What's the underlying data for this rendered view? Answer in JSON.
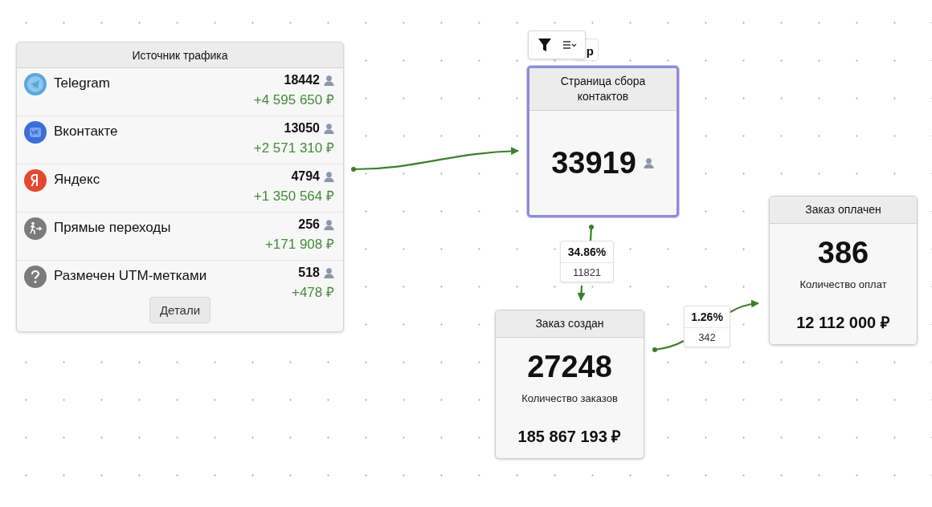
{
  "source_panel": {
    "title": "Источник трафика",
    "sources": [
      {
        "kind": "telegram",
        "name": "Telegram",
        "count": "18442",
        "revenue": "+4 595 650 ₽"
      },
      {
        "kind": "vk",
        "name": "Вконтакте",
        "count": "13050",
        "revenue": "+2 571 310 ₽"
      },
      {
        "kind": "yandex",
        "name": "Яндекс",
        "count": "4794",
        "revenue": "+1 350 564 ₽"
      },
      {
        "kind": "direct",
        "name": "Прямые переходы",
        "count": "256",
        "revenue": "+171 908 ₽"
      },
      {
        "kind": "utm",
        "name": "Размечен UTM-метками",
        "count": "518",
        "revenue": "+478 ₽"
      }
    ],
    "details_button": "Детали"
  },
  "hidden_label": "р",
  "nodes": [
    {
      "kind": "counter",
      "title": "Страница сбора контактов",
      "value": "33919",
      "selected": true
    },
    {
      "kind": "metric",
      "title": "Заказ создан",
      "value": "27248",
      "caption": "Количество заказов",
      "amount": "185 867 193 ₽",
      "selected": false
    },
    {
      "kind": "metric",
      "title": "Заказ оплачен",
      "value": "386",
      "caption": "Количество оплат",
      "amount": "12 112 000 ₽",
      "selected": false
    }
  ],
  "conversions": [
    {
      "percent": "34.86%",
      "count": "11821"
    },
    {
      "percent": "1.26%",
      "count": "342"
    }
  ]
}
